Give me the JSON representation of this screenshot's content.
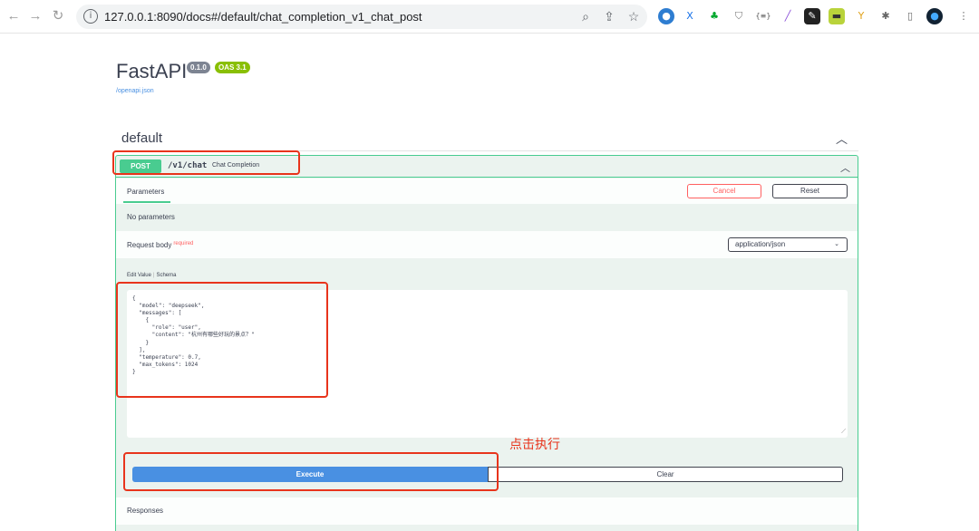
{
  "browser": {
    "url": "127.0.0.1:8090/docs#/default/chat_completion_v1_chat_post",
    "extensions": [
      "globe-ext-icon",
      "x-ext-icon",
      "evernote-ext-icon",
      "shield-ext-icon",
      "json-ext-icon",
      "pen-ext-icon",
      "chart-ext-icon",
      "box-ext-icon",
      "y-ext-icon",
      "puzzle-icon",
      "sidepanel-icon",
      "profile-avatar"
    ]
  },
  "api": {
    "title": "FastAPI",
    "version": "0.1.0",
    "oas": "OAS 3.1",
    "spec_link": "/openapi.json"
  },
  "tag": {
    "name": "default"
  },
  "operation": {
    "method": "POST",
    "path": "/v1/chat",
    "summary": "Chat Completion",
    "parameters_tab": "Parameters",
    "cancel_label": "Cancel",
    "reset_label": "Reset",
    "no_params": "No parameters",
    "request_body_label": "Request body",
    "required_label": "required",
    "content_type": "application/json",
    "edit_value_tab": "Edit Value",
    "schema_tab": "Schema",
    "body": "{\n  \"model\": \"deepseek\",\n  \"messages\": [\n    {\n      \"role\": \"user\",\n      \"content\": \"杭州有哪些好玩的景点？\"\n    }\n  ],\n  \"temperature\": 0.7,\n  \"max_tokens\": 1024\n}",
    "execute_label": "Execute",
    "clear_label": "Clear",
    "responses_label": "Responses"
  },
  "annotation": {
    "text": "点击执行",
    "color": "#e8341c"
  },
  "colors": {
    "post": "#49cc90",
    "execute": "#4990e2",
    "annotation": "#e8341c"
  }
}
